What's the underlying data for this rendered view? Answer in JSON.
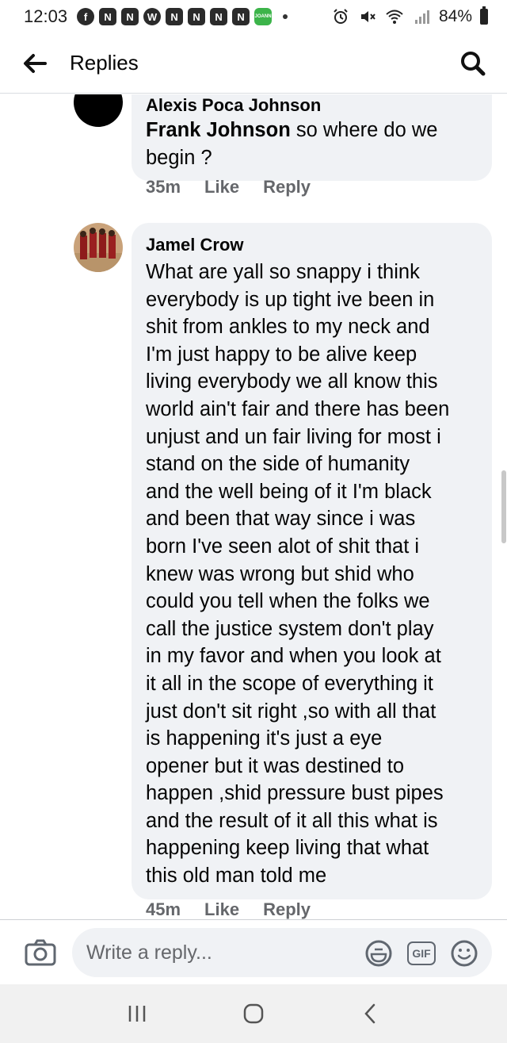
{
  "status_bar": {
    "time": "12:03",
    "notification_icons": [
      "N",
      "N",
      "W",
      "N",
      "N",
      "N",
      "N",
      "JOANN"
    ],
    "battery": "84%"
  },
  "header": {
    "title": "Replies"
  },
  "comments": [
    {
      "author_clipped": "Alexis Poca Johnson",
      "mention": "Frank Johnson",
      "text": " so where do we begin ?",
      "time": "35m",
      "like_label": "Like",
      "reply_label": "Reply"
    },
    {
      "author": "Jamel Crow",
      "text_lines": [
        "What are yall so snappy i think",
        "everybody is up tight ive been in",
        "shit from ankles to my neck and",
        "I'm  just happy  to be alive keep",
        "living  everybody we all know this",
        "world ain't  fair and there has been",
        "unjust and un fair living  for most i",
        "stand on the side of humanity",
        "and the well being of it I'm  black",
        "and been  that way since  i was",
        "born I've  seen alot of shit that i",
        "knew was wrong but shid who",
        "could you tell when the folks we",
        "call the justice  system  don't  play",
        "in my favor and when you look at",
        "it all in the scope of everything  it",
        "just don't  sit right ,so with all that",
        "is happening  it's  just a eye",
        "opener  but it was destined  to",
        "happen ,shid pressure  bust pipes",
        "and the result of it all this what is",
        "happening  keep living  that what",
        "this old  man told me"
      ],
      "time": "45m",
      "like_label": "Like",
      "reply_label": "Reply"
    }
  ],
  "composer": {
    "placeholder": "Write a reply...",
    "gif_label": "GIF"
  },
  "colors": {
    "bubble_bg": "#f0f2f5",
    "meta_text": "#65676b",
    "text": "#050505"
  }
}
